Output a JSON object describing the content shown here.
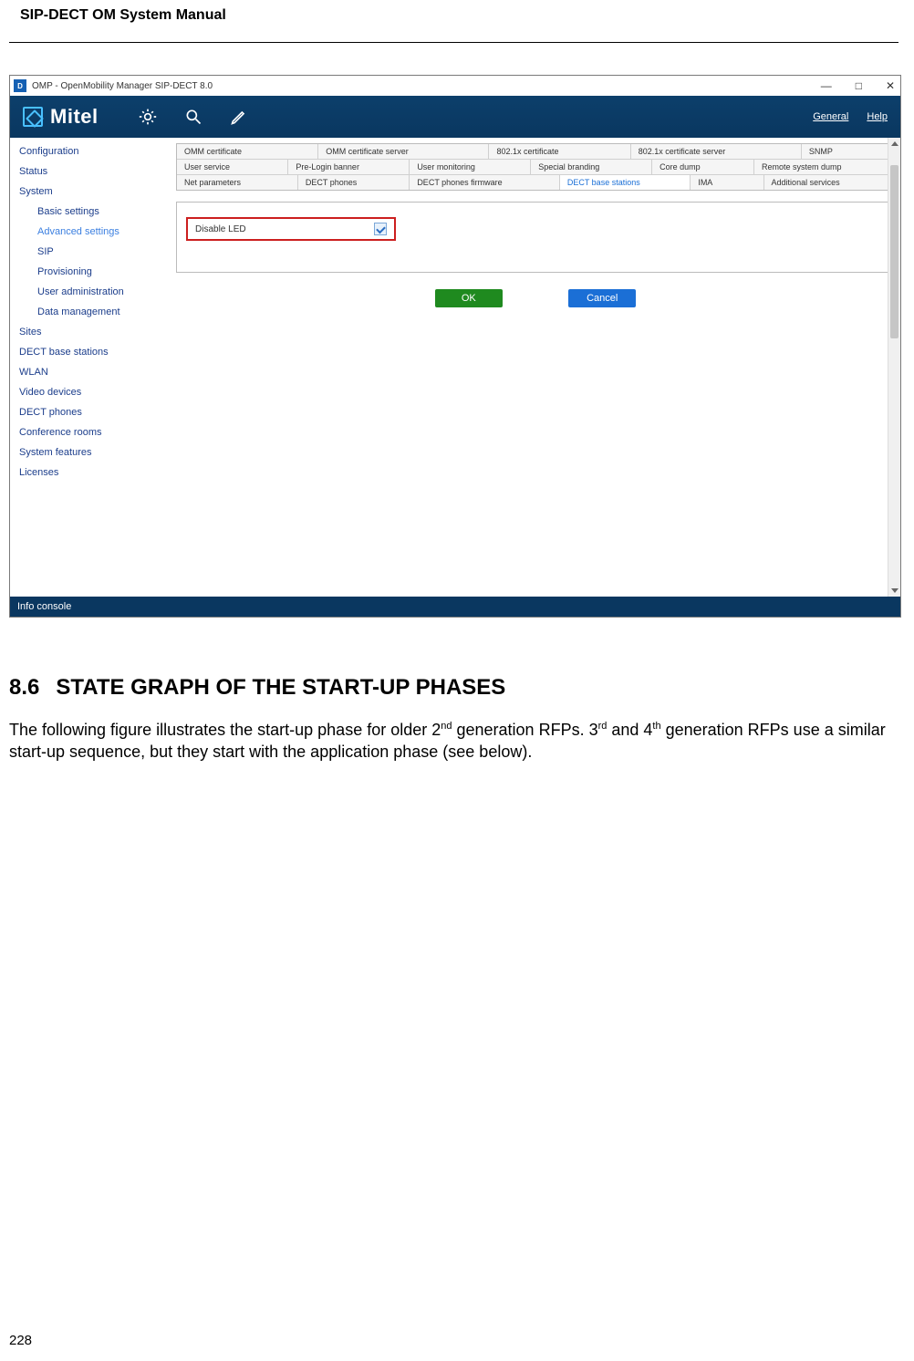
{
  "doc": {
    "header": "SIP-DECT OM System Manual",
    "page_number": "228",
    "section_number": "8.6",
    "section_title": "STATE GRAPH OF THE START-UP PHASES",
    "paragraph_part1": "The following figure illustrates the start-up phase for older 2",
    "sup1": "nd",
    "paragraph_part2": " generation RFPs. 3",
    "sup2": "rd",
    "paragraph_part3": " and 4",
    "sup3": "th",
    "paragraph_part4": " generation RFPs use a similar start-up sequence, but they start with the application phase (see below)."
  },
  "window": {
    "title": "OMP - OpenMobility Manager SIP-DECT 8.0",
    "logo_text": "Mitel",
    "menu_general": "General",
    "menu_help": "Help"
  },
  "sidebar": {
    "configuration": "Configuration",
    "status": "Status",
    "system": "System",
    "basic": "Basic settings",
    "advanced": "Advanced settings",
    "sip": "SIP",
    "provisioning": "Provisioning",
    "user_admin": "User administration",
    "data_mgmt": "Data management",
    "sites": "Sites",
    "dect_base": "DECT base stations",
    "wlan": "WLAN",
    "video": "Video devices",
    "dect_phones": "DECT phones",
    "conf_rooms": "Conference rooms",
    "sys_features": "System features",
    "licenses": "Licenses"
  },
  "tabs": {
    "row1": [
      "OMM certificate",
      "OMM certificate server",
      "802.1x certificate",
      "802.1x certificate server",
      "SNMP"
    ],
    "row2": [
      "User service",
      "Pre-Login banner",
      "User monitoring",
      "Special branding",
      "Core dump",
      "Remote system dump"
    ],
    "row3": [
      "Net parameters",
      "DECT phones",
      "DECT phones firmware",
      "DECT base stations",
      "IMA",
      "Additional services"
    ],
    "active": "DECT base stations"
  },
  "form": {
    "field_label": "Disable LED",
    "ok": "OK",
    "cancel": "Cancel"
  },
  "footer": {
    "info_console": "Info console"
  }
}
